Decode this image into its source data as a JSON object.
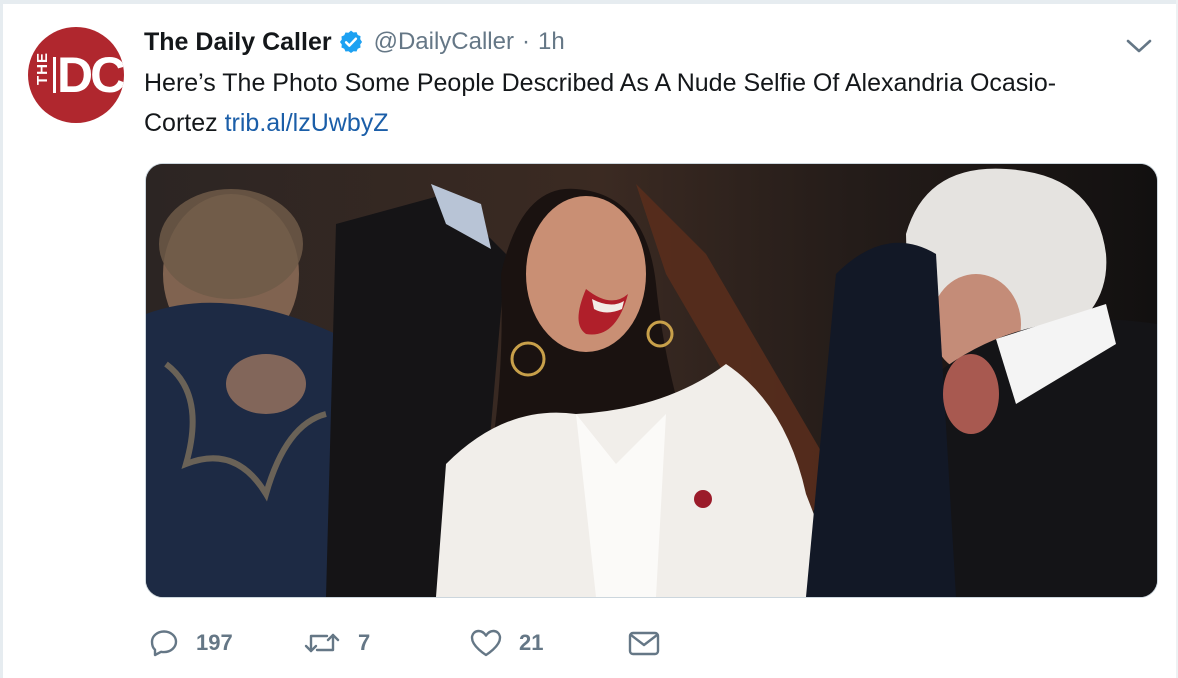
{
  "account": {
    "display_name": "The Daily Caller",
    "handle": "@DailyCaller",
    "separator": "·",
    "time": "1h",
    "avatar_letters_small": "THE",
    "avatar_letters_large": "DC",
    "avatar_color": "#b0272e",
    "verified_color": "#1da1f2"
  },
  "tweet": {
    "text": "Here’s The Photo Some People Described As A Nude Selfie Of Alexandria Ocasio-Cortez",
    "link": "trib.al/lzUwbyZ",
    "link_color": "#1b5ea8"
  },
  "actions": {
    "reply_count": "197",
    "retweet_count": "7",
    "like_count": "21"
  },
  "icons": {
    "menu": "chevron-down-icon",
    "reply": "reply-icon",
    "retweet": "retweet-icon",
    "like": "heart-icon",
    "share": "envelope-icon",
    "verified": "verified-badge-icon"
  }
}
